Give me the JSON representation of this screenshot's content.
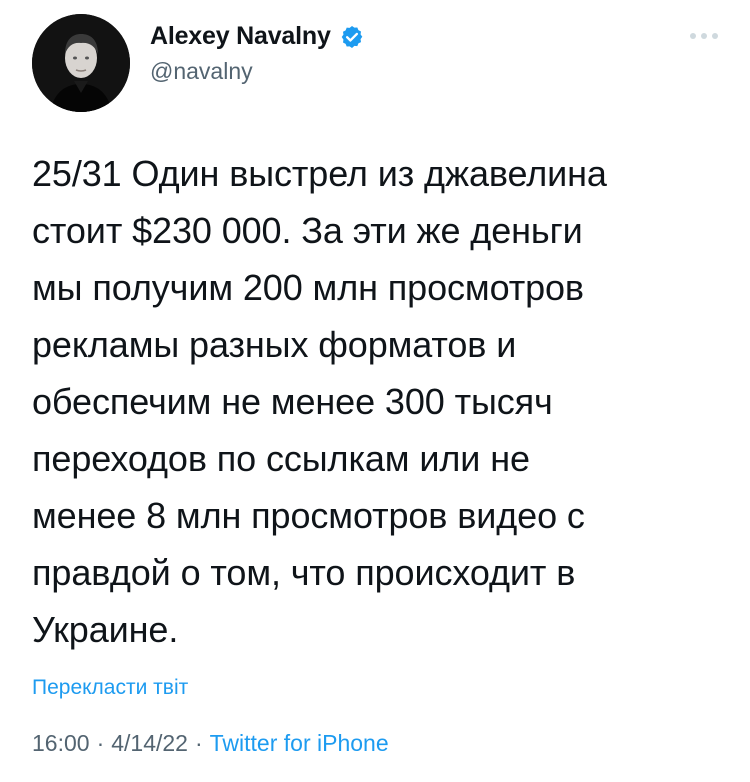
{
  "author": {
    "display_name": "Alexey Navalny",
    "handle": "@navalny"
  },
  "tweet": {
    "text": "25/31 Один выстрел из джавелина\nстоит $230 000. За эти же деньги\nмы получим 200 млн просмотров\nрекламы разных форматов и\nобеспечим не менее 300 тысяч\nпереходов по ссылкам или не\nменее 8 млн просмотров видео с\nправдой о том, что происходит в\nУкраине.",
    "translate_label": "Перекласти твіт",
    "time": "16:00",
    "separator_1": "·",
    "date": "4/14/22",
    "separator_2": "·",
    "source": "Twitter for iPhone"
  },
  "icons": {
    "verified": "verified-badge-icon",
    "more": "more-options-icon"
  },
  "colors": {
    "link": "#1d9bf0",
    "secondary_text": "#536471",
    "primary_text": "#0f1419",
    "verified_badge": "#1d9bf0"
  }
}
